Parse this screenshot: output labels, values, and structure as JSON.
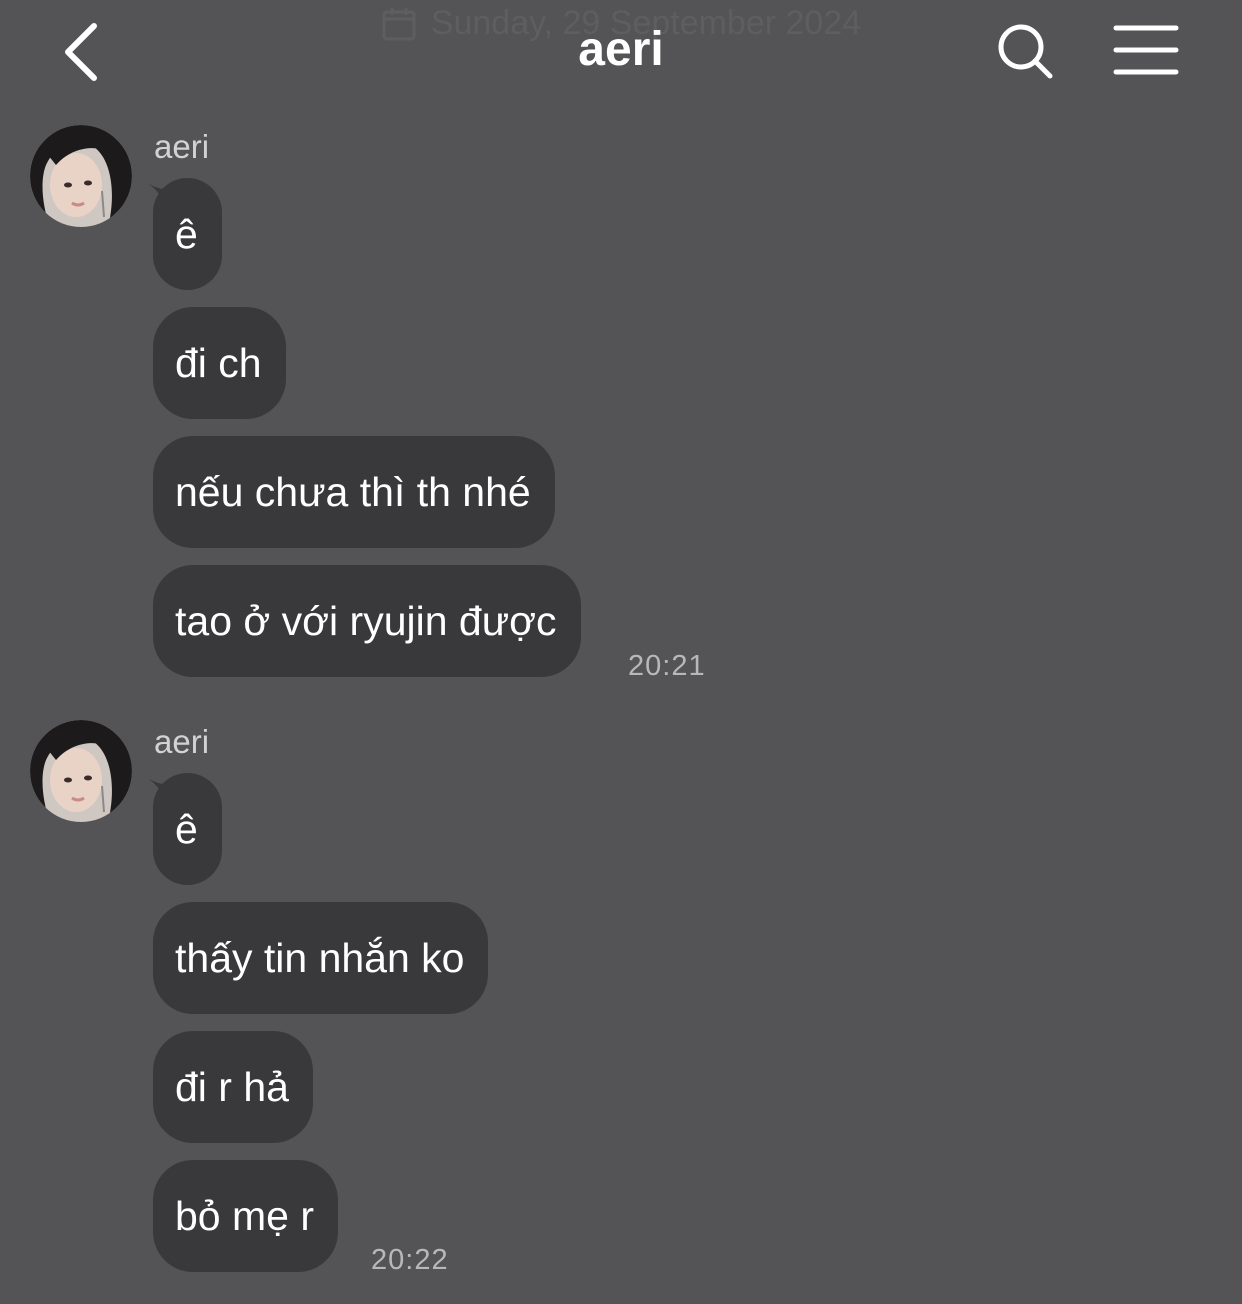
{
  "header": {
    "title": "aeri",
    "date_overlay": "Sunday, 29 September 2024",
    "back_icon": "chevron-left-icon",
    "search_icon": "search-icon",
    "menu_icon": "hamburger-menu-icon"
  },
  "colors": {
    "background": "#545355",
    "bubble": "#39383b",
    "text": "#ffffff",
    "timestamp": "#b8b7ba"
  },
  "groups": [
    {
      "sender": "aeri",
      "messages": [
        "ê",
        "đi ch",
        "nếu chưa thì th nhé",
        "tao ở với ryujin được"
      ],
      "time": "20:21"
    },
    {
      "sender": "aeri",
      "messages": [
        "ê",
        "thấy tin nhắn ko",
        "đi r hả",
        "bỏ mẹ r"
      ],
      "time": "20:22"
    }
  ]
}
